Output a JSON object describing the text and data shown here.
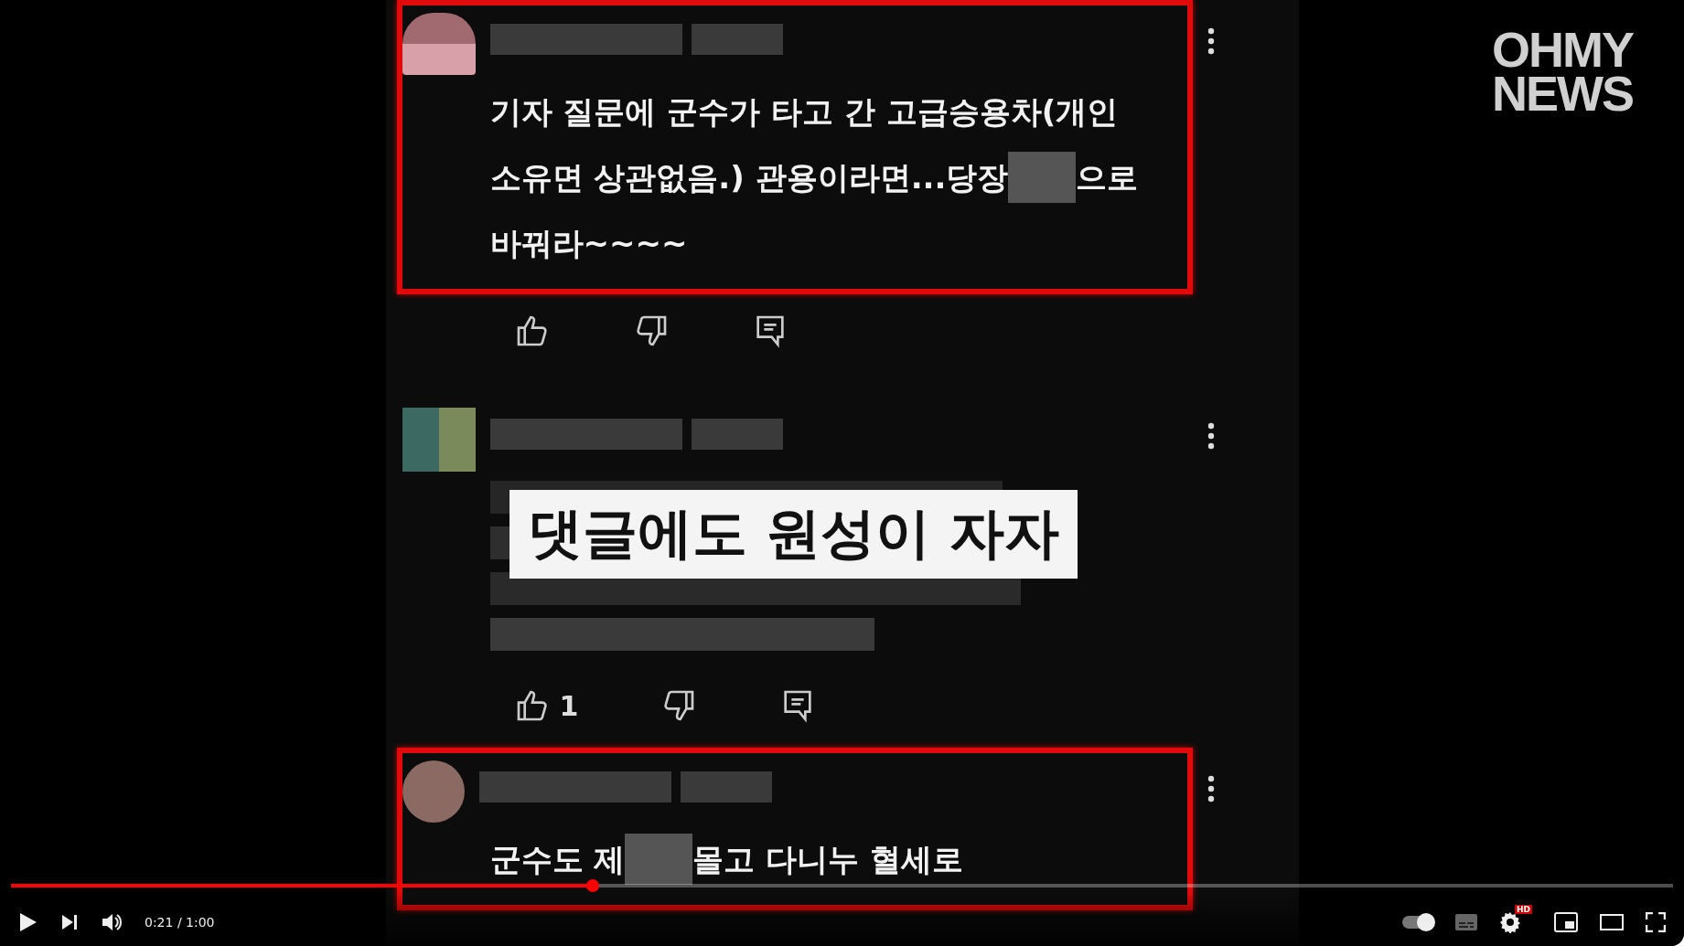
{
  "logo": {
    "lines": [
      "OHMY",
      "NEWS"
    ]
  },
  "comments": [
    {
      "highlighted": true,
      "kind": "text",
      "lines": [
        [
          {
            "kind": "text",
            "text": "기자 질문에 군수가 타고 간 고급승용차(개인"
          }
        ],
        [
          {
            "kind": "text",
            "text": "소유면 상관없음.) 관용이라면...당장"
          },
          {
            "kind": "redacted"
          },
          {
            "kind": "text",
            "text": "으로"
          }
        ],
        [
          {
            "kind": "text",
            "text": "바꿔라~~~~"
          }
        ]
      ]
    },
    {
      "highlighted": false,
      "kind": "pixelated",
      "likes": "1",
      "caption": "댓글에도 원성이 자자"
    },
    {
      "highlighted": true,
      "kind": "text",
      "lines": [
        [
          {
            "kind": "text",
            "text": "군수도 제"
          },
          {
            "kind": "redacted"
          },
          {
            "kind": "text",
            "text": "몰고 다니누 혈세로"
          }
        ]
      ]
    }
  ],
  "player": {
    "level": 0.35,
    "time": "0:21 / 1:00",
    "autoplay": true,
    "settings_badge": "HD"
  }
}
